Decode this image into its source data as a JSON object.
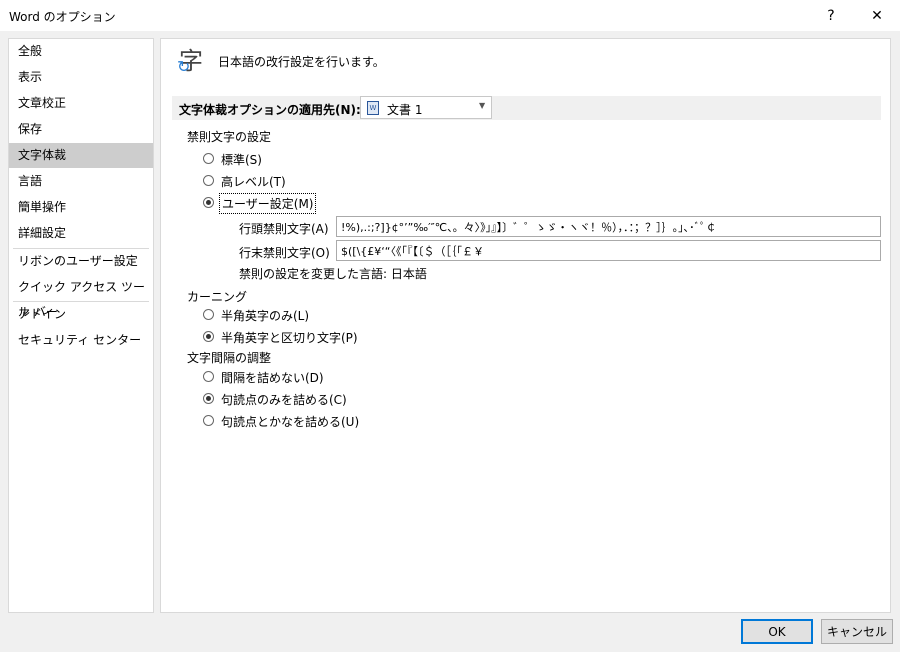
{
  "window": {
    "title": "Word のオプション",
    "help": "?",
    "close": "✕"
  },
  "sidebar": {
    "items": [
      "全般",
      "表示",
      "文章校正",
      "保存",
      "文字体裁",
      "言語",
      "簡単操作",
      "詳細設定",
      "リボンのユーザー設定",
      "クイック アクセス ツール バー",
      "アドイン",
      "セキュリティ センター"
    ],
    "selected": "文字体裁"
  },
  "header": {
    "icon": "typography-icon",
    "icon_char": "字",
    "text": "日本語の改行設定を行います。"
  },
  "apply_to": {
    "label": "文字体裁オプションの適用先(N):",
    "value": "文書 1"
  },
  "kinsoku": {
    "heading": "禁則文字の設定",
    "options": [
      "標準(S)",
      "高レベル(T)",
      "ユーザー設定(M)"
    ],
    "selected": 2,
    "line_start_label": "行頭禁則文字(A)",
    "line_start_value": "!%),.:;?]}¢°’”‰′″℃、。々〉》」』】〕゛゜ゝゞ・ヽヾ！％），．：；？］｝｡｣､･ﾞﾟ￠",
    "line_end_label": "行末禁則文字(O)",
    "line_end_value": "$([\\{£¥‘“〈《「『【〔＄（［｛｢￡￥",
    "note": "禁則の設定を変更した言語: 日本語"
  },
  "kerning": {
    "heading": "カーニング",
    "options": [
      "半角英字のみ(L)",
      "半角英字と区切り文字(P)"
    ],
    "selected": 1
  },
  "spacing": {
    "heading": "文字間隔の調整",
    "options": [
      "間隔を詰めない(D)",
      "句読点のみを詰める(C)",
      "句読点とかなを詰める(U)"
    ],
    "selected": 1
  },
  "buttons": {
    "ok": "OK",
    "cancel": "キャンセル"
  }
}
